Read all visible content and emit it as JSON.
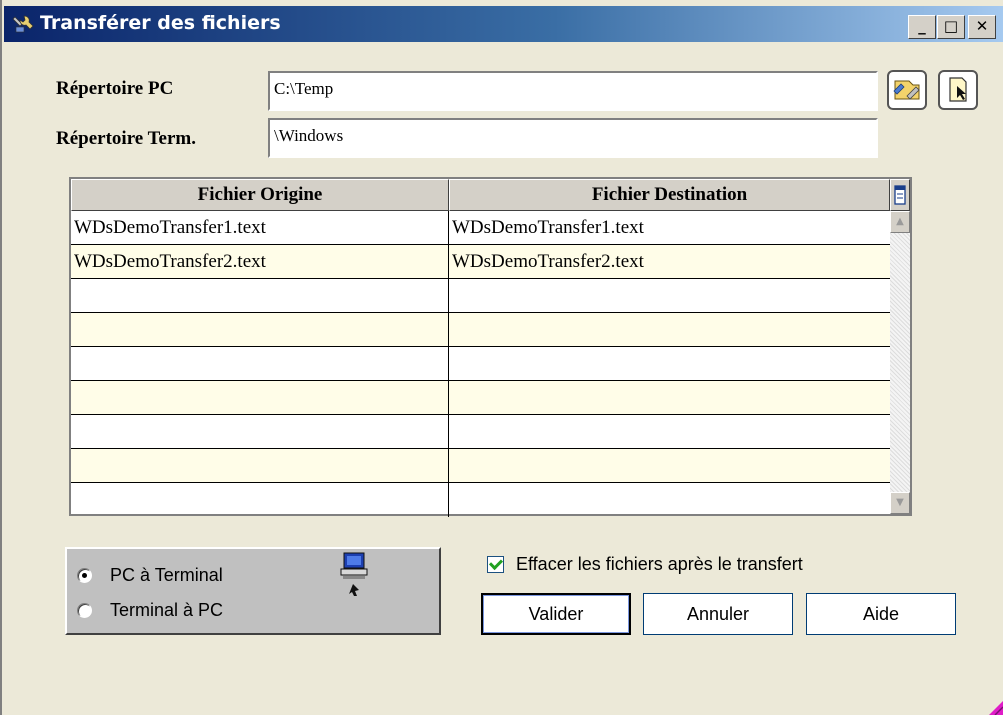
{
  "window": {
    "title": "Transférer des fichiers",
    "minimize": "_",
    "maximize": "□",
    "close": "✕"
  },
  "form": {
    "pc_dir_label": "Répertoire PC",
    "pc_dir_value": "C:\\Temp",
    "term_dir_label": "Répertoire Term.",
    "term_dir_value": "\\Windows"
  },
  "table": {
    "columns": [
      "Fichier Origine",
      "Fichier Destination"
    ],
    "rows": [
      [
        "WDsDemoTransfer1.text",
        "WDsDemoTransfer1.text"
      ],
      [
        "WDsDemoTransfer2.text",
        "WDsDemoTransfer2.text"
      ],
      [
        "",
        ""
      ],
      [
        "",
        ""
      ],
      [
        "",
        ""
      ],
      [
        "",
        ""
      ],
      [
        "",
        ""
      ],
      [
        "",
        ""
      ],
      [
        "",
        ""
      ]
    ]
  },
  "direction": {
    "options": [
      "PC à Terminal",
      "Terminal à PC"
    ],
    "selected": "PC à Terminal"
  },
  "delete_after": {
    "label": "Effacer les fichiers après le transfert",
    "checked": true
  },
  "buttons": {
    "validate": "Valider",
    "cancel": "Annuler",
    "help": "Aide"
  },
  "colors": {
    "titlebar_start": "#0A246A",
    "titlebar_end": "#A6CAF0",
    "window_bg": "#ECE9D8",
    "row_alt": "#FFFDE8",
    "check": "#21A121"
  },
  "icons": {
    "title": "tools-transfer-icon",
    "browse": "folder-browse-icon",
    "open": "file-open-icon",
    "table_corner": "column-menu-icon",
    "computer": "computer-icon"
  }
}
